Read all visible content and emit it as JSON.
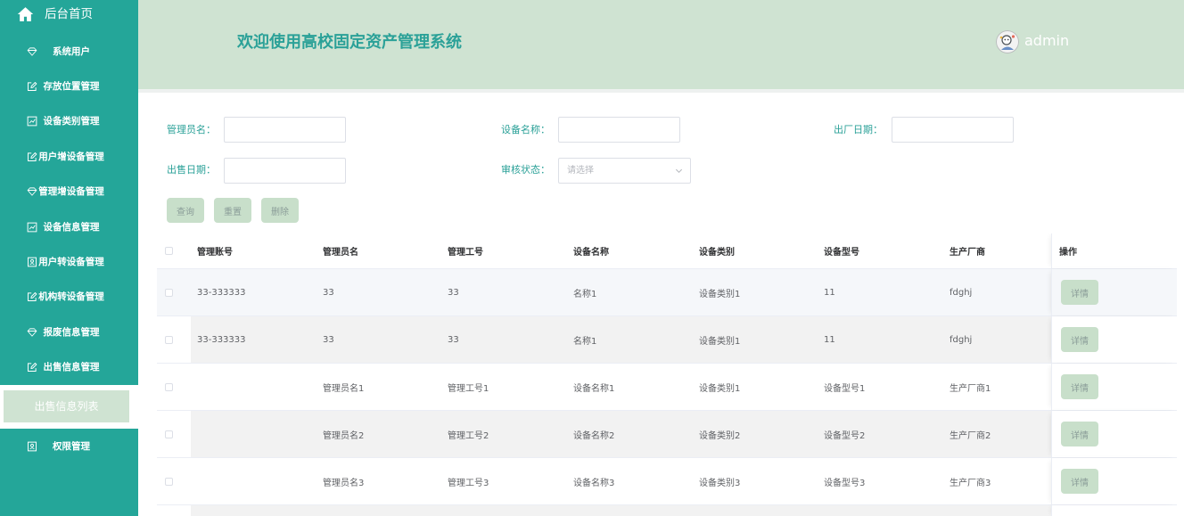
{
  "theme": {
    "sidebar_bg": "#24a699",
    "header_bg": "#cfe3d2",
    "accent": "#2ba198",
    "button_bg": "#c8dfca"
  },
  "sidebar": {
    "home": {
      "label": "后台首页",
      "icon": "home-icon"
    },
    "items": [
      {
        "label": "系统用户",
        "icon": "diamond-icon"
      },
      {
        "label": "存放位置管理",
        "icon": "edit-icon"
      },
      {
        "label": "设备类别管理",
        "icon": "chart-icon"
      },
      {
        "label": "用户增设备管理",
        "icon": "edit-icon"
      },
      {
        "label": "管理增设备管理",
        "icon": "diamond-icon"
      },
      {
        "label": "设备信息管理",
        "icon": "chart-icon"
      },
      {
        "label": "用户转设备管理",
        "icon": "id-card-icon"
      },
      {
        "label": "机构转设备管理",
        "icon": "edit-icon"
      },
      {
        "label": "报废信息管理",
        "icon": "diamond-icon"
      },
      {
        "label": "出售信息管理",
        "icon": "edit-icon"
      }
    ],
    "submenu": {
      "active_label": "出售信息列表"
    },
    "permissions": {
      "label": "权限管理",
      "icon": "id-card-icon"
    }
  },
  "header": {
    "title": "欢迎使用高校固定资产管理系统",
    "username": "admin"
  },
  "search": {
    "admin_name_label": "管理员名：",
    "device_name_label": "设备名称：",
    "factory_date_label": "出厂日期：",
    "sale_date_label": "出售日期：",
    "review_status_label": "审核状态：",
    "review_status_placeholder": "请选择",
    "buttons": {
      "query": "查询",
      "reset": "重置",
      "delete": "删除"
    }
  },
  "table": {
    "columns": {
      "admin_account": "管理账号",
      "admin_name": "管理员名",
      "admin_no": "管理工号",
      "device_name": "设备名称",
      "device_category": "设备类别",
      "device_model": "设备型号",
      "manufacturer": "生产厂商",
      "action": "操作"
    },
    "detail_label": "详情",
    "rows": [
      {
        "admin_account": "33-333333",
        "admin_name": "33",
        "admin_no": "33",
        "device_name": "名称1",
        "device_category": "设备类别1",
        "device_model": "11",
        "manufacturer": "fdghj"
      },
      {
        "admin_account": "33-333333",
        "admin_name": "33",
        "admin_no": "33",
        "device_name": "名称1",
        "device_category": "设备类别1",
        "device_model": "11",
        "manufacturer": "fdghj"
      },
      {
        "admin_account": "",
        "admin_name": "管理员名1",
        "admin_no": "管理工号1",
        "device_name": "设备名称1",
        "device_category": "设备类别1",
        "device_model": "设备型号1",
        "manufacturer": "生产厂商1"
      },
      {
        "admin_account": "",
        "admin_name": "管理员名2",
        "admin_no": "管理工号2",
        "device_name": "设备名称2",
        "device_category": "设备类别2",
        "device_model": "设备型号2",
        "manufacturer": "生产厂商2"
      },
      {
        "admin_account": "",
        "admin_name": "管理员名3",
        "admin_no": "管理工号3",
        "device_name": "设备名称3",
        "device_category": "设备类别3",
        "device_model": "设备型号3",
        "manufacturer": "生产厂商3"
      }
    ]
  }
}
